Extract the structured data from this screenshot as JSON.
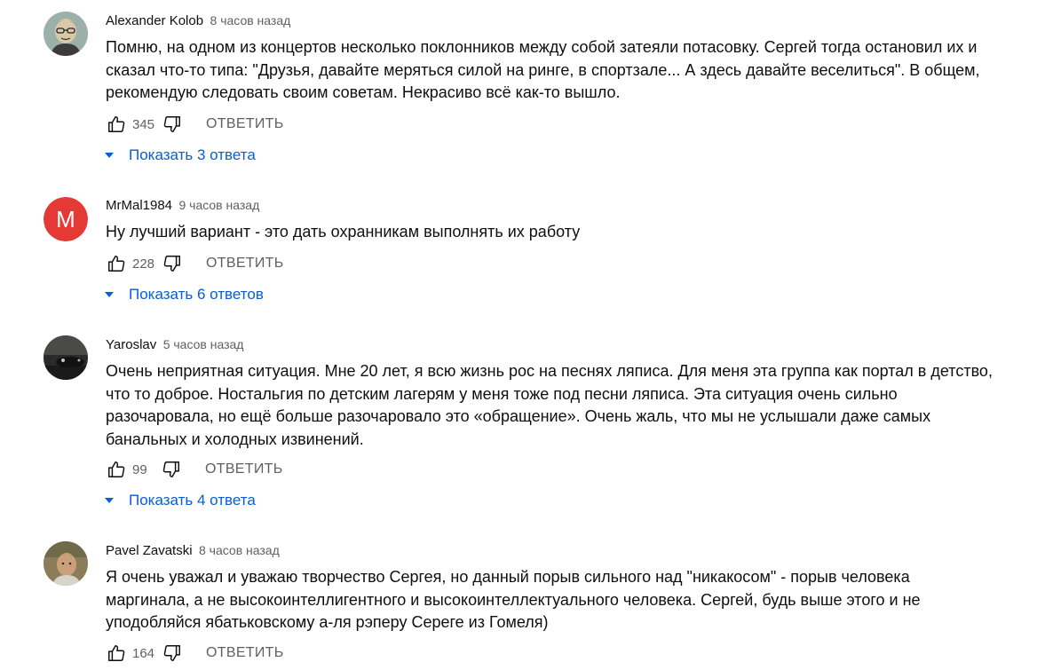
{
  "comments": [
    {
      "author": "Alexander Kolob",
      "time": "8 часов назад",
      "text": "Помню, на одном из концертов  несколько поклонников между собой затеяли потасовку. Сергей тогда остановил их и сказал что-то типа: \"Друзья, давайте меряться силой на ринге, в спортзале... А здесь давайте веселиться\". В общем, рекомендую следовать своим советам. Некрасиво всё как-то вышло.",
      "likes": "345",
      "reply_label": "ОТВЕТИТЬ",
      "replies_label": "Показать 3 ответа"
    },
    {
      "author": "MrMal1984",
      "time": "9 часов назад",
      "avatar_letter": "M",
      "avatar_color": "#e53935",
      "text": "Ну лучший вариант - это дать охранникам выполнять их работу",
      "likes": "228",
      "reply_label": "ОТВЕТИТЬ",
      "replies_label": "Показать 6 ответов"
    },
    {
      "author": "Yaroslav",
      "time": "5 часов назад",
      "text": "Очень неприятная ситуация. Мне 20 лет, я всю жизнь рос на песнях ляписа. Для меня эта группа как портал в детство, что то доброе. Ностальгия по детским лагерям у меня тоже под песни ляписа. Эта ситуация очень сильно разочаровала, но ещё больше разочаровало это «обращение». Очень жаль, что мы не услышали даже самых банальных и холодных извинений.",
      "likes": "99",
      "reply_label": "ОТВЕТИТЬ",
      "replies_label": "Показать 4 ответа"
    },
    {
      "author": "Pavel Zavatski",
      "time": "8 часов назад",
      "text": "Я очень уважал и уважаю творчество Сергея, но данный порыв сильного над \"никакосом\" - порыв человека маргинала, а не высокоинтеллигентного и высокоинтеллектуального человека. Сергей, будь выше этого и не уподобляйся ябатьковскому а-ля рэперу Сереге из Гомеля)",
      "likes": "164",
      "reply_label": "ОТВЕТИТЬ"
    }
  ],
  "icons": {
    "like": "thumbs-up-icon",
    "dislike": "thumbs-down-icon",
    "expand": "caret-down-icon"
  },
  "colors": {
    "link": "#065fd4",
    "secondary_text": "#606060",
    "primary_text": "#0f0f0f"
  }
}
